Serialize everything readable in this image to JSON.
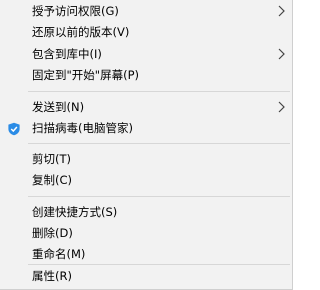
{
  "context_menu": {
    "items": [
      {
        "label": "授予访问权限(G)",
        "submenu": true
      },
      {
        "label": "还原以前的版本(V)",
        "submenu": false
      },
      {
        "label": "包含到库中(I)",
        "submenu": true
      },
      {
        "label": "固定到\"开始\"屏幕(P)",
        "submenu": false
      },
      {
        "label": "发送到(N)",
        "submenu": true
      },
      {
        "label": "扫描病毒(电脑管家)",
        "submenu": false,
        "icon": "shield-check-icon"
      },
      {
        "label": "剪切(T)",
        "submenu": false
      },
      {
        "label": "复制(C)",
        "submenu": false
      },
      {
        "label": "创建快捷方式(S)",
        "submenu": false
      },
      {
        "label": "删除(D)",
        "submenu": false
      },
      {
        "label": "重命名(M)",
        "submenu": false
      },
      {
        "label": "属性(R)",
        "submenu": false
      }
    ]
  },
  "colors": {
    "menu_background": "#f2f2f2",
    "separator": "#d7d7d7",
    "text": "#000000",
    "shield_icon": "#2b8ce6"
  }
}
